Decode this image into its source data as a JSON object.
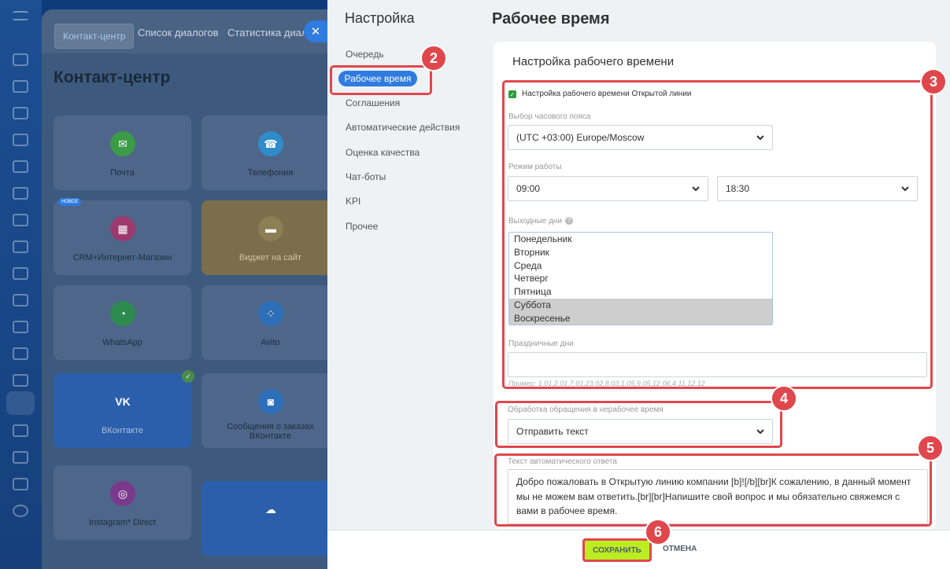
{
  "background": {
    "tabs": [
      "Контакт-центр",
      "Список диалогов",
      "Статистика диалогов"
    ],
    "title": "Контакт-центр",
    "new_badge": "НОВОЕ",
    "cards": [
      {
        "label": "Почта",
        "icon": "mail-icon"
      },
      {
        "label": "Телефония",
        "icon": "phone-icon"
      },
      {
        "label": "CRM+Интернет-Магазин",
        "icon": "shop-icon"
      },
      {
        "label": "Виджет на сайт",
        "icon": "chat-icon"
      },
      {
        "label": "WhatsApp",
        "icon": "whatsapp-icon"
      },
      {
        "label": "Avito",
        "icon": "avito-icon"
      },
      {
        "label": "ВКонтакте",
        "icon": "vk-icon"
      },
      {
        "label": "Сообщения о заказах ВКонтакте",
        "icon": "bag-icon"
      },
      {
        "label": "Instagram* Direct",
        "icon": "instagram-icon"
      }
    ]
  },
  "nav": {
    "title": "Настройка",
    "items": [
      "Очередь",
      "Рабочее время",
      "Соглашения",
      "Автоматические действия",
      "Оценка качества",
      "Чат-боты",
      "KPI",
      "Прочее"
    ],
    "selected": "Рабочее время"
  },
  "main": {
    "title": "Рабочее время",
    "subtitle": "Настройка рабочего времени",
    "checkbox_label": "Настройка рабочего времени Открытой линии",
    "timezone_label": "Выбор часового пояса",
    "timezone_value": "(UTC +03:00) Europe/Moscow",
    "mode_label": "Режим работы",
    "time_from": "09:00",
    "time_to": "18:30",
    "days_off_label": "Выходные дни",
    "days": [
      {
        "name": "Понедельник",
        "selected": false
      },
      {
        "name": "Вторник",
        "selected": false
      },
      {
        "name": "Среда",
        "selected": false
      },
      {
        "name": "Четверг",
        "selected": false
      },
      {
        "name": "Пятница",
        "selected": false
      },
      {
        "name": "Суббота",
        "selected": true
      },
      {
        "name": "Воскресенье",
        "selected": true
      }
    ],
    "holidays_label": "Праздничные дни",
    "holidays_value": "",
    "holidays_hint": "Пример: 1.01,2.01,7.01,23.02,8.03,1.05,9.05,12.06,4.11,12.12",
    "offhours_label": "Обработка обращения в нерабочее время",
    "offhours_value": "Отправить текст",
    "autoreply_label": "Текст автоматического ответа",
    "autoreply_text": "Добро пожаловать в Открытую линию компании [b]![/b][br]К сожалению, в данный момент мы не можем вам ответить.[br][br]Напишите свой вопрос и мы обязательно свяжемся с вами в рабочее время."
  },
  "footer": {
    "save": "СОХРАНИТЬ",
    "cancel": "ОТМЕНА"
  },
  "badges": [
    "2",
    "3",
    "4",
    "5",
    "6"
  ],
  "colors": {
    "accent": "#2f7be0",
    "highlight": "#e0474c",
    "save": "#bbed21"
  }
}
